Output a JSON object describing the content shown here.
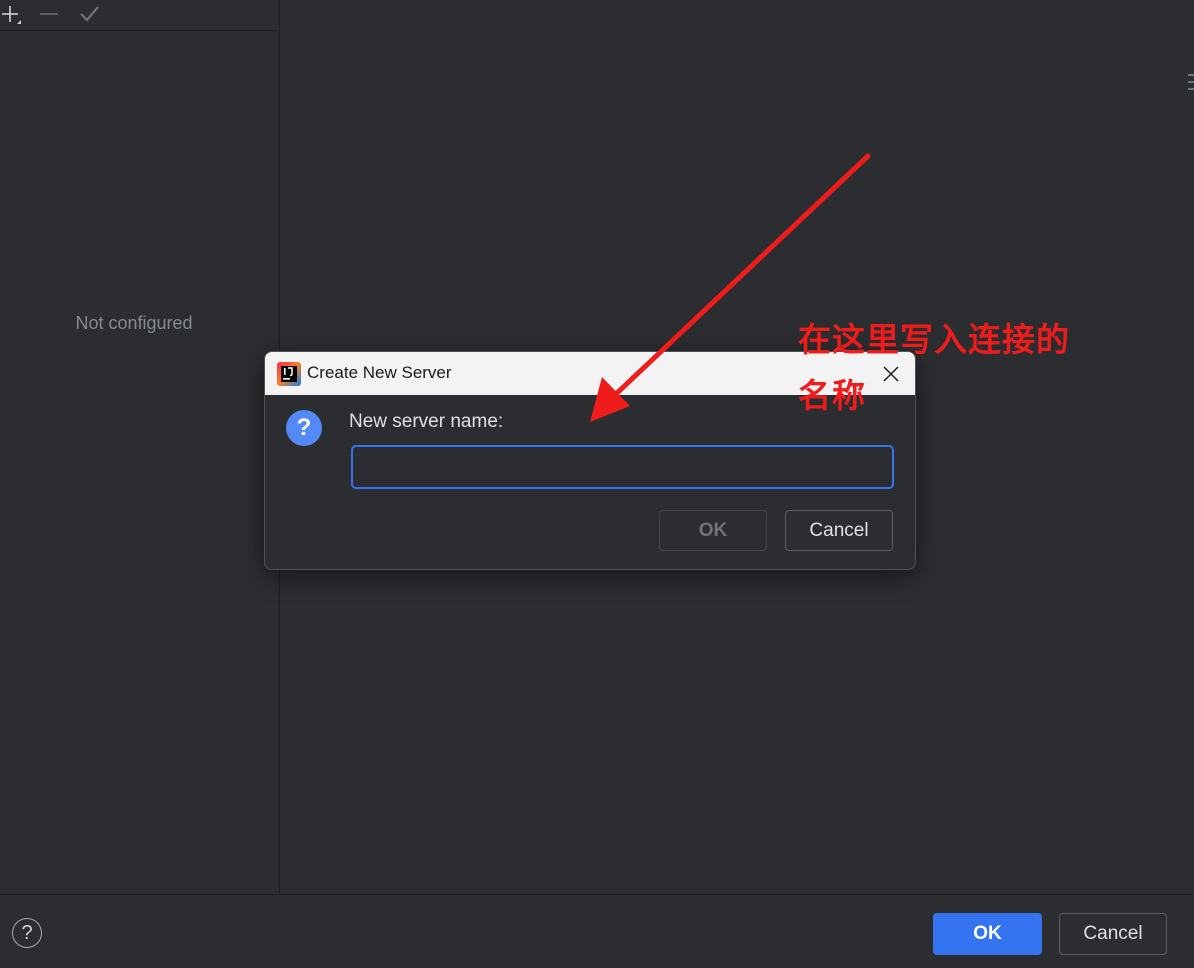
{
  "left_panel": {
    "empty_text": "Not configured",
    "toolbar": {
      "add_icon": "plus-icon",
      "remove_icon": "minus-icon",
      "apply_icon": "check-icon"
    }
  },
  "dialog": {
    "title": "Create New Server",
    "logo_icon": "intellij-logo-icon",
    "close_icon": "close-icon",
    "question_icon": "question-icon",
    "question_glyph": "?",
    "prompt": "New server name:",
    "input_value": "",
    "input_placeholder": "",
    "ok_label": "OK",
    "cancel_label": "Cancel"
  },
  "footer": {
    "help_glyph": "?",
    "ok_label": "OK",
    "cancel_label": "Cancel"
  },
  "annotation": {
    "line1": "在这里写入连接的",
    "line2": "名称",
    "color": "#ef1c1c"
  },
  "colors": {
    "accent": "#3574f0",
    "background": "#2b2d30",
    "question_icon": "#548af7"
  }
}
